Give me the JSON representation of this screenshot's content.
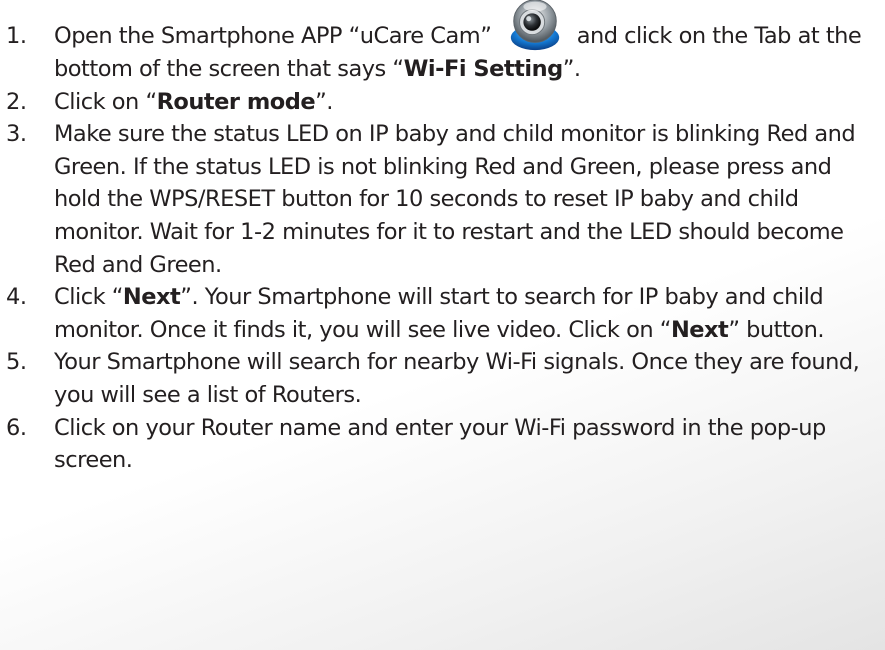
{
  "steps": [
    {
      "number": "1.",
      "parts": [
        {
          "text": "Open the Smartphone APP “uCare Cam”"
        },
        {
          "icon": "ucare-cam-app-icon"
        },
        {
          "text": "and click on the Tab at the bottom of the screen that says “"
        },
        {
          "text": "Wi-Fi Setting",
          "bold": true
        },
        {
          "text": "”."
        }
      ]
    },
    {
      "number": "2.",
      "parts": [
        {
          "text": "Click on “"
        },
        {
          "text": "Router mode",
          "bold": true
        },
        {
          "text": "”."
        }
      ]
    },
    {
      "number": "3.",
      "parts": [
        {
          "text": "Make sure the status LED on IP baby and child monitor is blinking Red and Green. If the status LED is not blinking Red and Green, please press and hold the WPS/RESET button for 10 seconds to reset IP baby and child monitor. Wait for 1-2 minutes for it to restart and the LED should become Red and Green."
        }
      ]
    },
    {
      "number": "4.",
      "parts": [
        {
          "text": "Click “"
        },
        {
          "text": "Next",
          "bold": true
        },
        {
          "text": "”. Your Smartphone will start to search for IP baby and child monitor. Once it finds it, you will see live video. Click on “"
        },
        {
          "text": "Next",
          "bold": true
        },
        {
          "text": "” button."
        }
      ]
    },
    {
      "number": "5.",
      "parts": [
        {
          "text": "Your Smartphone will search for nearby Wi-Fi signals. Once they are found, you will see a list of Routers."
        }
      ]
    },
    {
      "number": "6.",
      "parts": [
        {
          "text": "Click on your Router name and enter your Wi-Fi password in the pop-up screen."
        }
      ]
    }
  ]
}
